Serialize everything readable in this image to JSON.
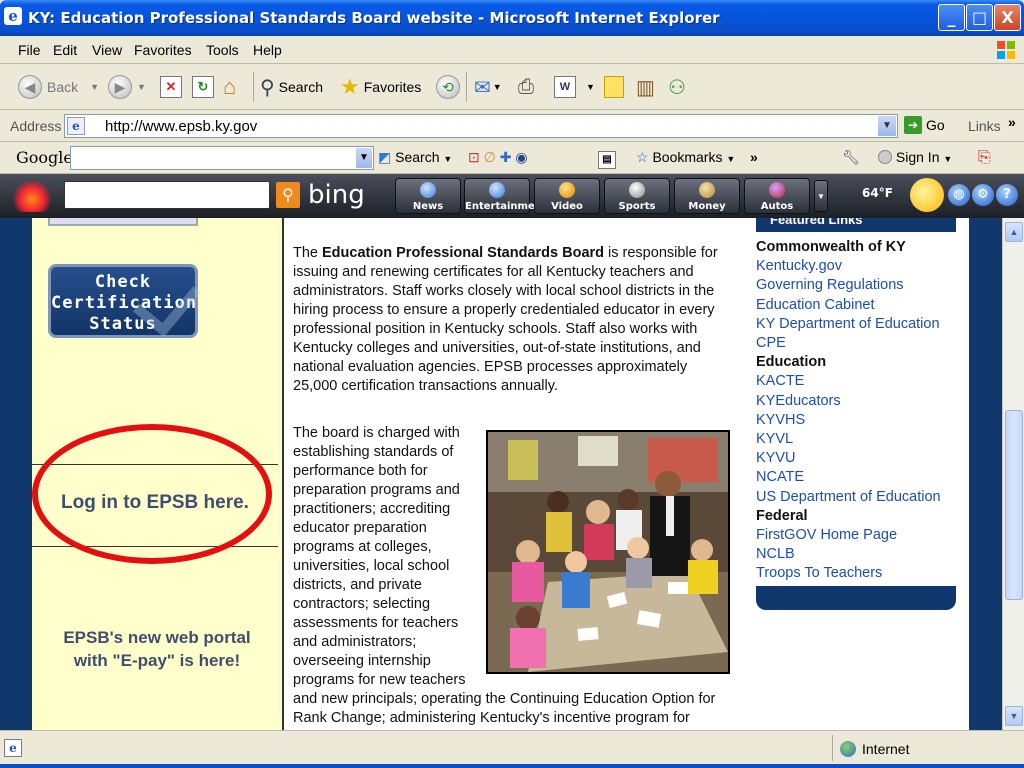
{
  "window": {
    "title": "KY: Education Professional Standards Board website - Microsoft Internet Explorer",
    "min": "_",
    "max": "□",
    "close": "X"
  },
  "menu": [
    "File",
    "Edit",
    "View",
    "Favorites",
    "Tools",
    "Help"
  ],
  "toolbar": {
    "back": "Back",
    "search": "Search",
    "favorites": "Favorites"
  },
  "address": {
    "label": "Address",
    "url": "http://www.epsb.ky.gov",
    "go": "Go",
    "links": "Links"
  },
  "google_bar": {
    "logo": "Google",
    "search": "Search",
    "bookmarks": "Bookmarks",
    "sign_in": "Sign In"
  },
  "bing_bar": {
    "logo": "bing",
    "buttons": [
      "News",
      "Entertainment",
      "Video",
      "Sports",
      "Money",
      "Autos"
    ],
    "temperature": "64°F"
  },
  "left": {
    "check_button_line1": "Check",
    "check_button_line2": "Certification",
    "check_button_line3": "Status",
    "login": "Log in to EPSB here.",
    "portal_line1": "EPSB's new web portal",
    "portal_line2": "with \"E-pay\" is here!"
  },
  "main": {
    "p1_prefix": "The ",
    "p1_bold": "Education Professional Standards Board",
    "p1_rest": " is responsible for issuing and renewing certificates for all Kentucky teachers and administrators. Staff works closely with local school districts in the hiring process to ensure a properly credentialed educator in every professional position in Kentucky schools. Staff also works with Kentucky colleges and universities, out-of-state institutions, and national evaluation agencies. EPSB processes approximately 25,000 certification transactions annually.",
    "p2_part1": "The board is charged with establishing standards of performance both for preparation programs and practitioners; accrediting educator preparation programs at colleges, universities, local school districts, and private contractors; selecting assessments for teachers and administrators; overseeing internship programs for new teachers",
    "p2_part2": "and new principals; operating the Continuing Education Option for Rank Change; administering Kentucky's incentive program for"
  },
  "featured": {
    "header": "Featured Links",
    "groups": [
      {
        "heading": "Commonwealth of KY",
        "links": [
          "Kentucky.gov",
          "Governing Regulations",
          "Education Cabinet",
          "KY Department of Education",
          "CPE"
        ]
      },
      {
        "heading": "Education",
        "links": [
          "KACTE",
          "KYEducators",
          "KYVHS",
          "KYVL",
          "KYVU",
          "NCATE",
          "US Department of Education"
        ]
      },
      {
        "heading": "Federal",
        "links": [
          "FirstGOV Home Page",
          "NCLB",
          "Troops To Teachers"
        ]
      }
    ]
  },
  "status": {
    "zone": "Internet"
  }
}
